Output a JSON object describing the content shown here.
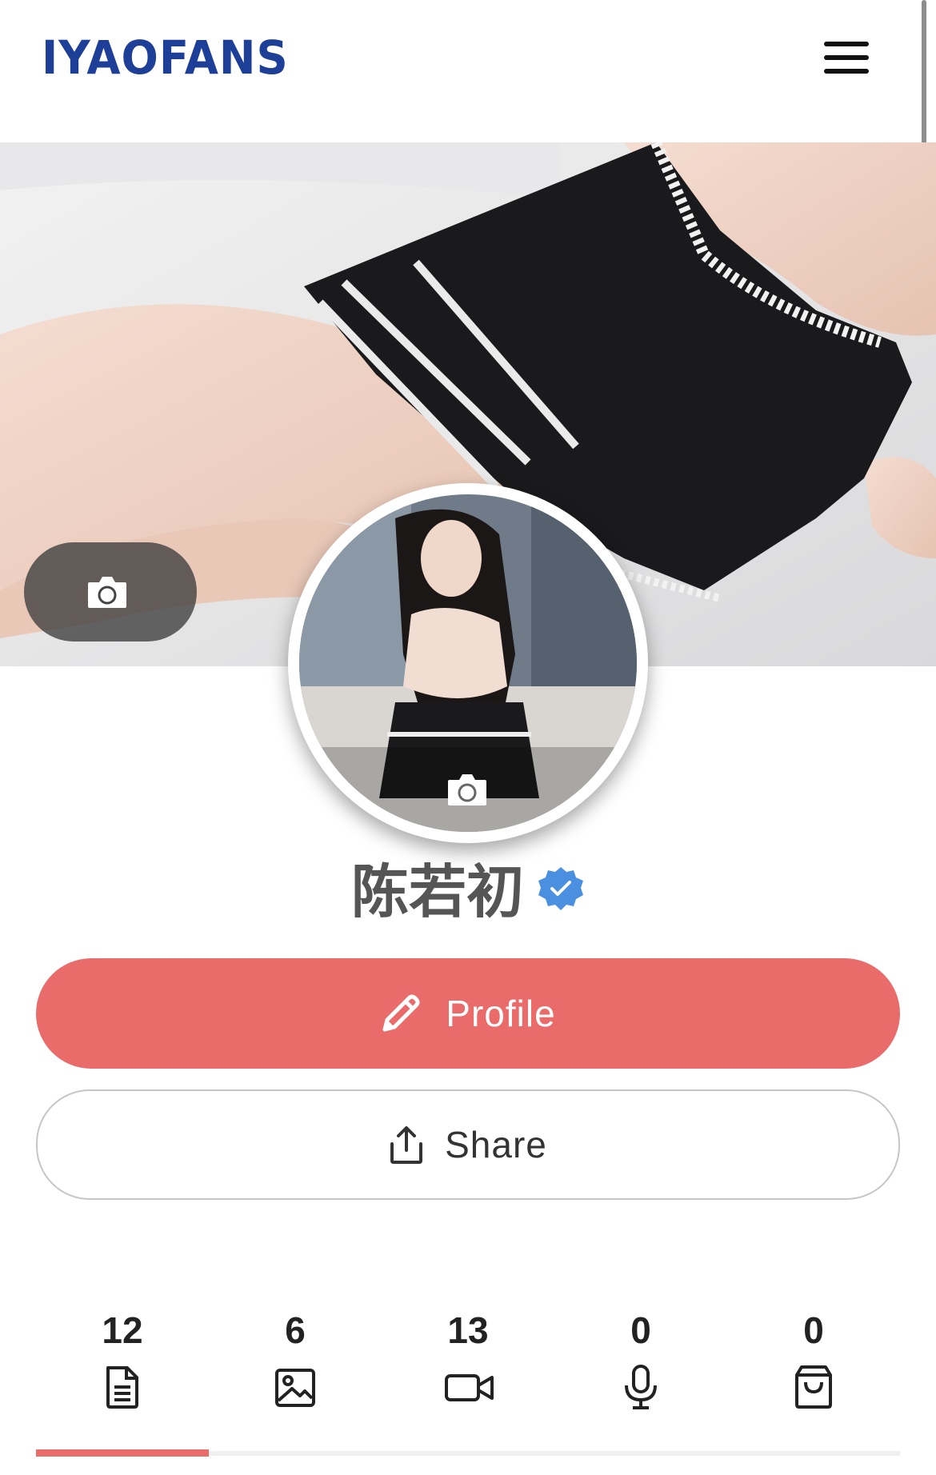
{
  "header": {
    "logo": "IYAOFANS",
    "menu_icon": "hamburger-menu-icon"
  },
  "cover": {
    "camera_icon": "camera-icon"
  },
  "avatar": {
    "camera_icon": "camera-icon"
  },
  "profile": {
    "name": "陈若初",
    "verified_icon": "verified-badge-icon",
    "verified_color": "#4a8fe0"
  },
  "actions": {
    "profile_label": "Profile",
    "profile_icon": "pencil-icon",
    "share_label": "Share",
    "share_icon": "share-icon",
    "accent_color": "#e96c6b"
  },
  "tabs": [
    {
      "count": "12",
      "icon": "document-icon"
    },
    {
      "count": "6",
      "icon": "image-icon"
    },
    {
      "count": "13",
      "icon": "video-icon"
    },
    {
      "count": "0",
      "icon": "microphone-icon"
    },
    {
      "count": "0",
      "icon": "shopping-bag-icon"
    }
  ]
}
